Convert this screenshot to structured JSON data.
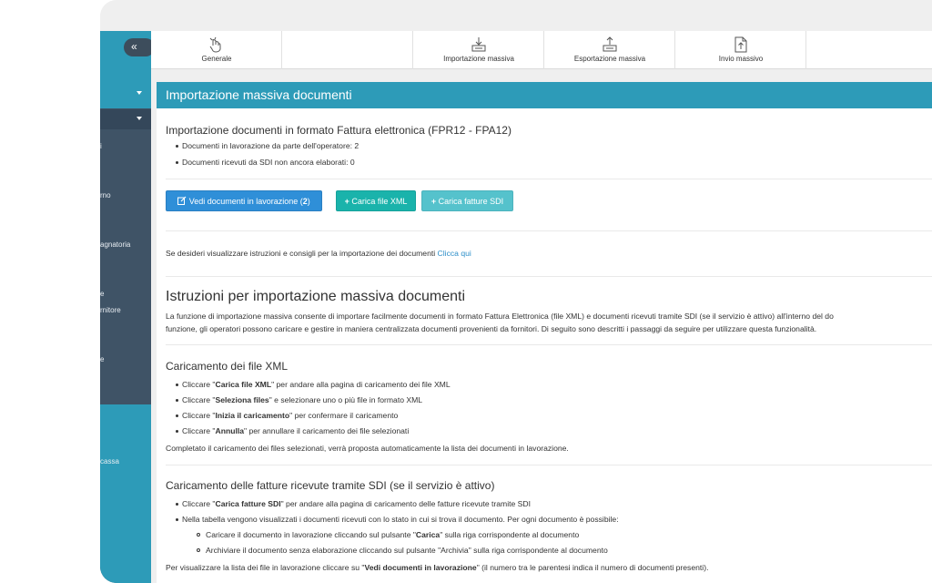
{
  "sidebar": {
    "collapse_label": "«",
    "items": [
      {
        "label": "i"
      },
      {
        "label": "rno"
      },
      {
        "label": "agnatoria"
      },
      {
        "label": "e"
      },
      {
        "label": "rnitore"
      },
      {
        "label": "e"
      },
      {
        "label": "cassa"
      }
    ]
  },
  "tabs": [
    {
      "label": "Generale",
      "icon": "hand-pointer-icon"
    },
    {
      "label": "",
      "icon": ""
    },
    {
      "label": "Importazione massiva",
      "icon": "import-icon"
    },
    {
      "label": "Esportazione massiva",
      "icon": "export-icon"
    },
    {
      "label": "Invio massivo",
      "icon": "file-upload-icon"
    },
    {
      "label": "",
      "icon": ""
    }
  ],
  "panel": {
    "title": "Importazione massiva documenti",
    "import_heading": "Importazione documenti in formato Fattura elettronica (FPR12 - FPA12)",
    "stats": [
      "Documenti in lavorazione da parte dell'operatore: 2",
      "Documenti ricevuti da SDI non ancora elaborati: 0"
    ],
    "buttons": {
      "view_label": "Vedi documenti in lavorazione (",
      "view_count": "2",
      "view_close": ")",
      "xml_label": "Carica file XML",
      "sdi_label": "Carica fatture SDI"
    },
    "help_text": "Se desideri visualizzare istruzioni e consigli per la importazione dei documenti",
    "help_link": "Clicca qui",
    "instructions_title": "Istruzioni per importazione massiva documenti",
    "intro_line1": "La funzione di importazione massiva consente di importare facilmente documenti in formato Fattura Elettronica (file XML) e documenti ricevuti tramite SDI (se il servizio è attivo) all'interno del do",
    "intro_line2": "funzione, gli operatori possono caricare e gestire in maniera centralizzata documenti provenienti da fornitori. Di seguito sono descritti i passaggi da seguire per utilizzare questa funzionalità.",
    "xml_section": {
      "title": "Caricamento dei file XML",
      "items": [
        {
          "pre": "Cliccare \"",
          "bold": "Carica file XML",
          "post": "\" per andare alla pagina di caricamento dei file XML"
        },
        {
          "pre": "Cliccare \"",
          "bold": "Seleziona files",
          "post": "\" e selezionare uno o più file in formato XML"
        },
        {
          "pre": "Cliccare \"",
          "bold": "Inizia il caricamento",
          "post": "\" per confermare il caricamento"
        },
        {
          "pre": "Cliccare \"",
          "bold": "Annulla",
          "post": "\" per annullare il caricamento dei file selezionati"
        }
      ],
      "footer": "Completato il caricamento dei files selezionati, verrà proposta automaticamente la lista dei documenti in lavorazione."
    },
    "sdi_section": {
      "title": "Caricamento delle fatture ricevute tramite SDI (se il servizio è attivo)",
      "item1": {
        "pre": "Cliccare \"",
        "bold": "Carica fatture SDI",
        "post": "\" per andare alla pagina di caricamento delle fatture ricevute tramite SDI"
      },
      "item2": "Nella tabella vengono visualizzati i documenti ricevuti con lo stato in cui si trova il documento. Per ogni documento è possibile:",
      "sub1": {
        "pre": "Caricare il documento in lavorazione cliccando sul pulsante \"",
        "bold": "Carica",
        "post": "\" sulla riga corrispondente al documento"
      },
      "sub2": "Archiviare il documento senza elaborazione cliccando sul pulsante \"Archivia\" sulla riga corrispondente al documento",
      "footer": {
        "pre": "Per visualizzare la lista dei file in lavorazione cliccare su \"",
        "bold": "Vedi documenti in lavorazione",
        "post": "\" (il numero tra le parentesi indica il numero di documenti presenti)."
      }
    }
  }
}
